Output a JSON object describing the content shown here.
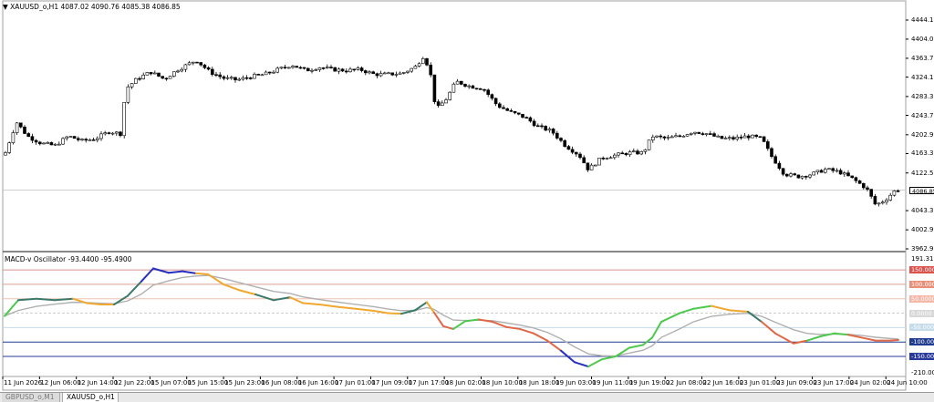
{
  "main_panel": {
    "symbol_line": "XAUUSD_o,H1  4087.02 4090.76 4085.38 4086.85",
    "price_labels": [
      "4444.10",
      "4404.00",
      "4363.70",
      "4324.10",
      "4283.30",
      "4243.70",
      "4202.90",
      "4163.30",
      "4122.50",
      "4043.30",
      "4002.90",
      "3962.90"
    ],
    "current_price_tag": "4086.85",
    "current_price": 4086.85
  },
  "indicator_panel": {
    "title": "MACD-v Oscillator -93.4400 -95.4900",
    "top_value": "191.313",
    "bottom_value": "-210.003",
    "levels": [
      {
        "label": "150.0000",
        "value": 150,
        "color": "#d9534f",
        "text_color": "#ffffff",
        "line": "#d99090"
      },
      {
        "label": "100.0000",
        "value": 100,
        "color": "#e8907a",
        "text_color": "#ffffff",
        "line": "#e0a090"
      },
      {
        "label": "50.0000",
        "value": 50,
        "color": "#f4b8a8",
        "text_color": "#ffffff",
        "line": "#f0c0b0"
      },
      {
        "label": "0.0000",
        "value": 0,
        "color": "#d8d8d8",
        "text_color": "#ffffff",
        "line": "#c8c8c8"
      },
      {
        "label": "-50.0000",
        "value": -50,
        "color": "#c6dcea",
        "text_color": "#ffffff",
        "line": "#c6dcea"
      },
      {
        "label": "-100.0000",
        "value": -100,
        "color": "#1f3c8f",
        "text_color": "#ffffff",
        "line": "#1f3c8f"
      },
      {
        "label": "-150.0000",
        "value": -150,
        "color": "#2a3a9a",
        "text_color": "#ffffff",
        "line": "#2a3a9a"
      }
    ]
  },
  "time_labels": [
    "11 Jun 2026",
    "12 Jun 06:00",
    "12 Jun 14:00",
    "12 Jun 22:00",
    "15 Jun 07:00",
    "15 Jun 15:00",
    "15 Jun 23:00",
    "16 Jun 08:00",
    "16 Jun 16:00",
    "17 Jun 01:00",
    "17 Jun 09:00",
    "17 Jun 17:00",
    "18 Jun 02:00",
    "18 Jun 10:00",
    "18 Jun 18:00",
    "19 Jun 03:00",
    "19 Jun 11:00",
    "19 Jun 19:00",
    "22 Jun 08:00",
    "22 Jun 16:00",
    "23 Jun 01:00",
    "23 Jun 09:00",
    "23 Jun 17:00",
    "24 Jun 02:00",
    "24 Jun 10:00"
  ],
  "tabs": [
    {
      "label": "GBPUSD_o,M1",
      "active": false
    },
    {
      "label": "XAUUSD_o,H1",
      "active": true
    }
  ],
  "colors": {
    "bull_candle": "#ffffff",
    "bear_candle": "#000000",
    "signal_line": "#b0b0b0",
    "macd_green": "#4ec94e",
    "macd_teal": "#3a7a6a",
    "macd_orange": "#f0a830",
    "macd_red": "#e06848",
    "macd_blue": "#2830c0"
  }
}
